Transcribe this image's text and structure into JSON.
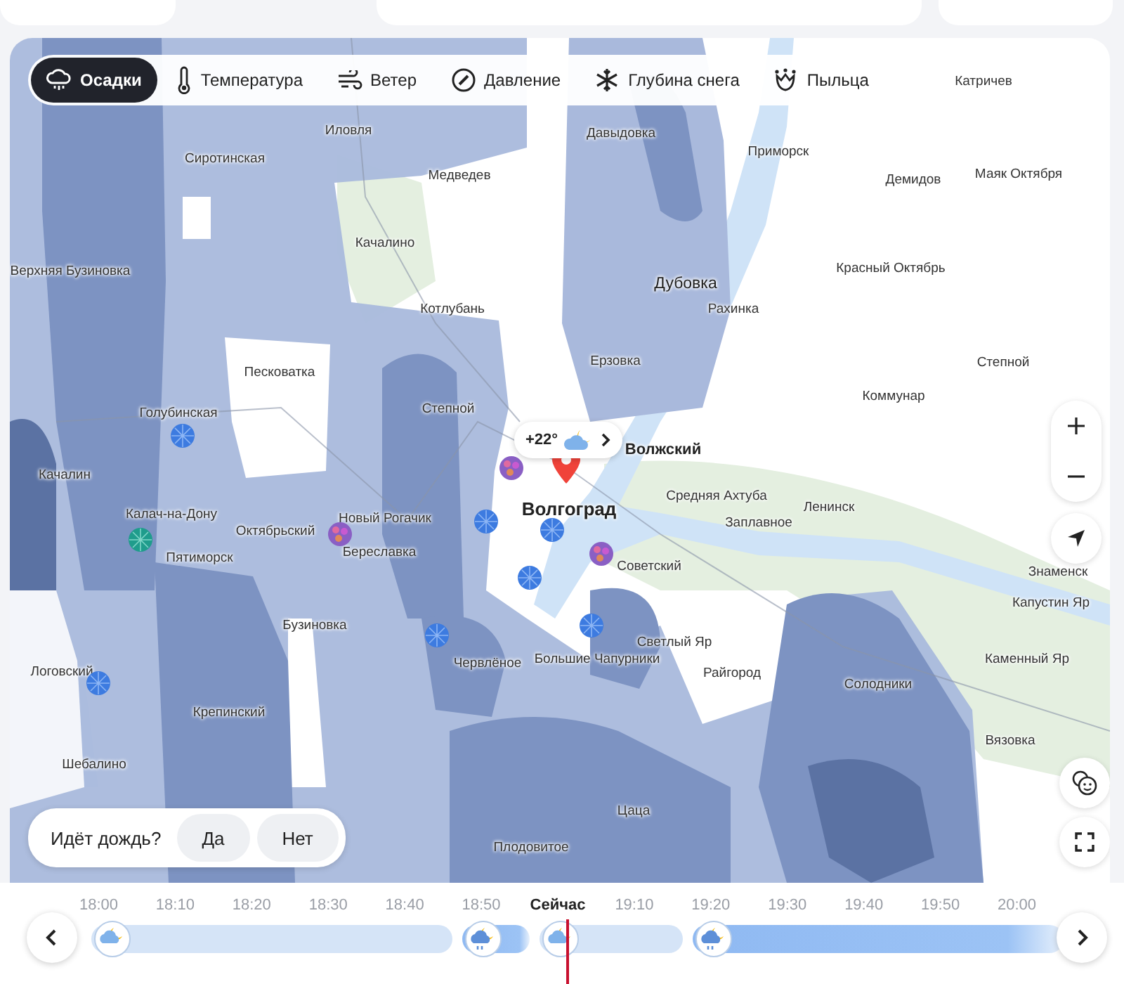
{
  "layer_tabs": [
    {
      "label": "Осадки",
      "kind": "precipitation",
      "selected": true
    },
    {
      "label": "Температура",
      "kind": "temperature",
      "selected": false
    },
    {
      "label": "Ветер",
      "kind": "wind",
      "selected": false
    },
    {
      "label": "Давление",
      "kind": "pressure",
      "selected": false
    },
    {
      "label": "Глубина снега",
      "kind": "snow",
      "selected": false
    },
    {
      "label": "Пыльца",
      "kind": "pollen",
      "selected": false
    }
  ],
  "map": {
    "places": [
      {
        "name": "Катричев",
        "kind": "village"
      },
      {
        "name": "Иловля",
        "kind": "village"
      },
      {
        "name": "Давыдовка",
        "kind": "village"
      },
      {
        "name": "Приморск",
        "kind": "village"
      },
      {
        "name": "Сиротинская",
        "kind": "village"
      },
      {
        "name": "Медведев",
        "kind": "village"
      },
      {
        "name": "Маяк Октября",
        "kind": "village"
      },
      {
        "name": "Демидов",
        "kind": "village"
      },
      {
        "name": "Качалино",
        "kind": "village"
      },
      {
        "name": "Верхняя Бузиновка",
        "kind": "village"
      },
      {
        "name": "Красный Октябрь",
        "kind": "village"
      },
      {
        "name": "Дубовка",
        "kind": "town"
      },
      {
        "name": "Котлубань",
        "kind": "village"
      },
      {
        "name": "Рахинка",
        "kind": "village"
      },
      {
        "name": "Степной",
        "kind": "village"
      },
      {
        "name": "Ерзовка",
        "kind": "village"
      },
      {
        "name": "Песковатка",
        "kind": "village"
      },
      {
        "name": "Коммунар",
        "kind": "village"
      },
      {
        "name": "Степной",
        "kind": "village"
      },
      {
        "name": "Голубинская",
        "kind": "village"
      },
      {
        "name": "Волжский",
        "kind": "city"
      },
      {
        "name": "Качалин",
        "kind": "village"
      },
      {
        "name": "Волгоград",
        "kind": "capital"
      },
      {
        "name": "Средняя Ахтуба",
        "kind": "village"
      },
      {
        "name": "Ленинск",
        "kind": "village"
      },
      {
        "name": "Калач-на-Дону",
        "kind": "village"
      },
      {
        "name": "Заплавное",
        "kind": "village"
      },
      {
        "name": "Новый Рогачик",
        "kind": "village"
      },
      {
        "name": "Октябрьский",
        "kind": "village"
      },
      {
        "name": "Береславка",
        "kind": "village"
      },
      {
        "name": "Пятиморск",
        "kind": "village"
      },
      {
        "name": "Советский",
        "kind": "village"
      },
      {
        "name": "Знаменск",
        "kind": "village"
      },
      {
        "name": "Капустин Яр",
        "kind": "village"
      },
      {
        "name": "Бузиновка",
        "kind": "village"
      },
      {
        "name": "Логовский",
        "kind": "village"
      },
      {
        "name": "Червлёное",
        "kind": "village"
      },
      {
        "name": "Большие Чапурники",
        "kind": "village"
      },
      {
        "name": "Светлый Яр",
        "kind": "village"
      },
      {
        "name": "Райгород",
        "kind": "village"
      },
      {
        "name": "Каменный Яр",
        "kind": "village"
      },
      {
        "name": "Солодники",
        "kind": "village"
      },
      {
        "name": "Крепинский",
        "kind": "village"
      },
      {
        "name": "Вязовка",
        "kind": "village"
      },
      {
        "name": "Шебалино",
        "kind": "village"
      },
      {
        "name": "Цаца",
        "kind": "village"
      },
      {
        "name": "Плодовитое",
        "kind": "village"
      }
    ],
    "weather_chip": {
      "temperature": "+22°"
    },
    "rain_question": {
      "question": "Идёт дождь?",
      "buttons": [
        "Да",
        "Нет"
      ]
    }
  },
  "timeline": {
    "times": [
      {
        "label": "18:00",
        "current": false
      },
      {
        "label": "18:10",
        "current": false
      },
      {
        "label": "18:20",
        "current": false
      },
      {
        "label": "18:30",
        "current": false
      },
      {
        "label": "18:40",
        "current": false
      },
      {
        "label": "18:50",
        "current": false
      },
      {
        "label": "Сейчас",
        "current": true
      },
      {
        "label": "19:10",
        "current": false
      },
      {
        "label": "19:20",
        "current": false
      },
      {
        "label": "19:30",
        "current": false
      },
      {
        "label": "19:40",
        "current": false
      },
      {
        "label": "19:50",
        "current": false
      },
      {
        "label": "20:00",
        "current": false
      }
    ],
    "segments": [
      {
        "kind": "cloudy"
      },
      {
        "kind": "rain"
      },
      {
        "kind": "cloudy"
      },
      {
        "kind": "rain"
      }
    ]
  }
}
